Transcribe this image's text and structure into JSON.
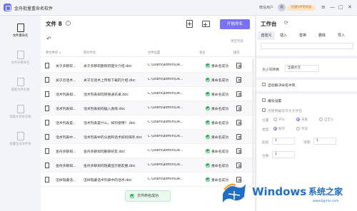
{
  "app": {
    "title": "金舟批量重命名软件",
    "user_label": "微信用户",
    "vip_label": "开通VIP享权益"
  },
  "window_controls": [
    "≡",
    "—",
    "□",
    "✕"
  ],
  "sidebar": {
    "items": [
      {
        "label": "文件重命名",
        "icon": "file-icon",
        "active": true
      },
      {
        "label": "文件夹重命名",
        "icon": "folder-icon",
        "active": false
      },
      {
        "label": "提取文件名称",
        "icon": "extract-icon",
        "active": false
      },
      {
        "label": "提取文件夹名称",
        "icon": "extract-folder-icon",
        "active": false
      },
      {
        "label": "批量生成文件夹",
        "icon": "generate-folder-icon",
        "active": false
      }
    ]
  },
  "main": {
    "title": "文件 8",
    "help": "?",
    "rename_button": "开始命名",
    "undo": "↶",
    "clear_list": "清空列表",
    "columns": [
      "原文件名 ↓",
      "新文件名",
      "文件位置",
      "状态",
      "操作"
    ],
    "rows": [
      {
        "orig": "关于多聊软...",
        "new": "关于多聊软删除的图文介绍.doc",
        "path": "C:\\Users\\admin\\De...",
        "status": "重命名成功"
      },
      {
        "orig": "关于云话术...",
        "new": "关于云话术上传和下载的介绍.doc",
        "path": "C:\\Users\\admin\\De...",
        "status": "重命名成功"
      },
      {
        "orig": "话术列表如...",
        "new": "话术列表如何转换通讯录.doc",
        "path": "C:\\Users\\admin\\De...",
        "status": "重命名成功"
      },
      {
        "orig": "话术列表如...",
        "new": "话术列表如何插入表情.doc",
        "path": "C:\\Users\\admin\\De...",
        "status": "重命名成功"
      },
      {
        "orig": "话术列表是...",
        "new": "话术列表是什么，如何使用？.doc",
        "path": "C:\\Users\\admin\\De...",
        "status": "重命名成功"
      },
      {
        "orig": "话术列表中...",
        "new": "话术列表中的分类和话术如何排序.doc",
        "path": "C:\\Users\\admin\\De...",
        "status": "重命名成功"
      },
      {
        "orig": "金舟多聊如...",
        "new": "金舟多聊如何删除好友.doc",
        "path": "C:\\Users\\admin\\De...",
        "status": "重命名成功"
      },
      {
        "orig": "金舟多聊如...",
        "new": "金舟多聊如何隐藏显示朋友圈.doc",
        "path": "C:\\Users\\admin\\De...",
        "status": "重命名成功"
      },
      {
        "orig": "怎样隐藏话...",
        "new": "怎样隐藏话术列表中的话术.doc",
        "path": "C:\\Users\\admin\\De...",
        "status": "重命名成功"
      }
    ],
    "toast": "文件命名成功"
  },
  "workspace": {
    "title": "工作台",
    "tabs": [
      "自定义",
      "插入",
      "替换",
      "删除",
      "导入"
    ],
    "case_label": "大小写转换",
    "case_value": "全部大写",
    "auto_replace_label": "自动解决命名冲突",
    "numbering_label": "编号设置",
    "use_number_label": "仅使用编号作为文件名",
    "position_label": "位置",
    "positions": [
      "开头",
      "末尾",
      "自定义"
    ],
    "type_label": "类型",
    "types": [
      "数字",
      "字母"
    ],
    "start_label": "起始",
    "start_value": "1",
    "step_label": "增量",
    "step_value": "1",
    "digits_label": "位数",
    "digits_value": "1"
  },
  "watermark": {
    "brand": "Windows",
    "suffix": "系统之家",
    "url": "www.bjjmlv.com"
  }
}
